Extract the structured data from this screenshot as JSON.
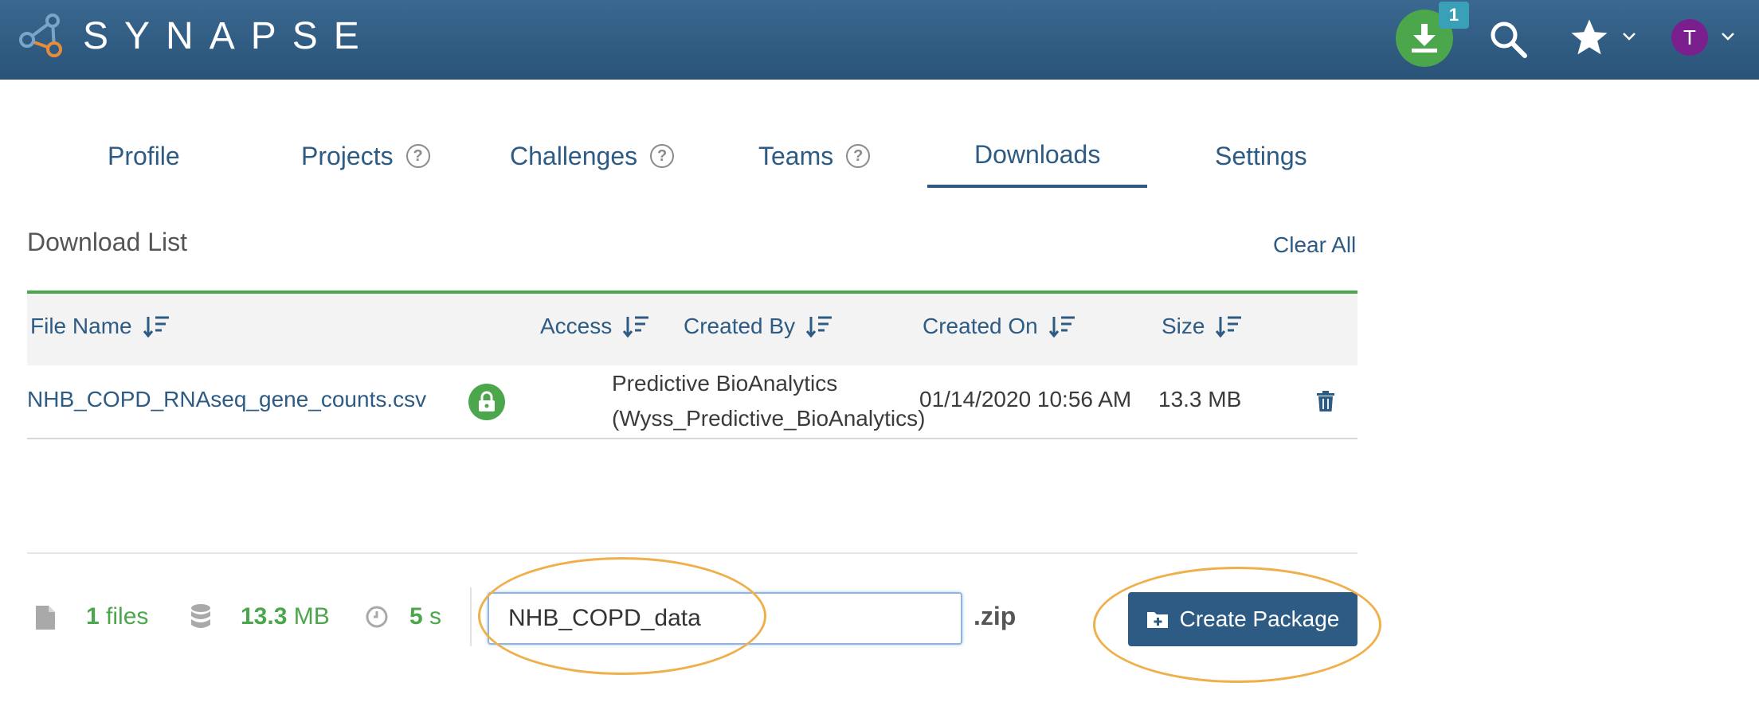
{
  "header": {
    "logo_text": "SYNAPSE",
    "download_badge": "1",
    "avatar_initial": "T",
    "icons": [
      "synapse-logo-icon",
      "download-icon",
      "search-icon",
      "star-icon",
      "chevron-down-icon",
      "avatar"
    ]
  },
  "tabs": [
    {
      "label": "Profile",
      "help": false,
      "active": false
    },
    {
      "label": "Projects",
      "help": true,
      "active": false
    },
    {
      "label": "Challenges",
      "help": true,
      "active": false
    },
    {
      "label": "Teams",
      "help": true,
      "active": false
    },
    {
      "label": "Downloads",
      "help": false,
      "active": true
    },
    {
      "label": "Settings",
      "help": false,
      "active": false
    }
  ],
  "help_glyph": "?",
  "download_list": {
    "title": "Download List",
    "clear_all": "Clear All",
    "columns": [
      "File Name",
      "Access",
      "Created By",
      "Created On",
      "Size"
    ],
    "rows": [
      {
        "file_name": "NHB_COPD_RNAseq_gene_counts.csv",
        "access": "lock-icon",
        "created_by_line1": "Predictive BioAnalytics",
        "created_by_line2": "(Wyss_Predictive_BioAnalytics)",
        "created_on": "01/14/2020 10:56 AM",
        "size": "13.3 MB"
      }
    ]
  },
  "footer": {
    "files_count": "1",
    "files_label": "files",
    "size_value": "13.3",
    "size_unit": "MB",
    "time_value": "5",
    "time_unit": "s",
    "package_name": "NHB_COPD_data",
    "extension": ".zip",
    "create_button": "Create Package"
  },
  "colors": {
    "header": "#2f5c82",
    "link": "#2d5b83",
    "green": "#4ca64c",
    "highlight": "#efb04c",
    "avatar": "#7b1f8e",
    "badge": "#3aa0b8"
  }
}
